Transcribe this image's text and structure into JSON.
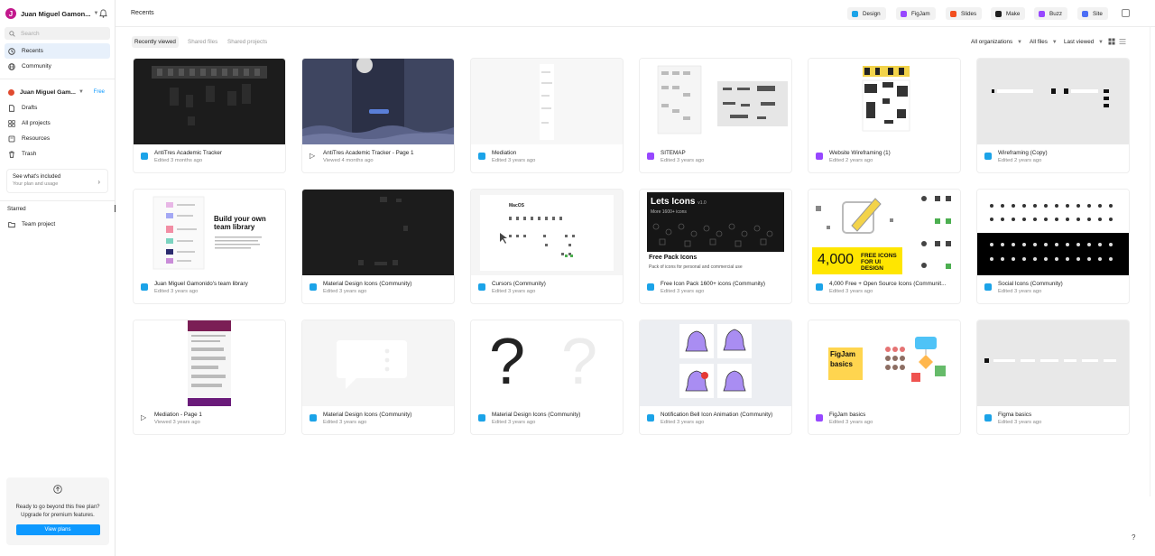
{
  "sidebar": {
    "avatar_initial": "J",
    "user_name": "Juan Miguel Gamon...",
    "search_placeholder": "Search",
    "nav": [
      {
        "label": "Recents",
        "icon": "clock-icon",
        "active": true
      },
      {
        "label": "Community",
        "icon": "globe-icon",
        "active": false
      }
    ],
    "team": {
      "name": "Juan Miguel Gam...",
      "badge": "Free"
    },
    "team_nav": [
      {
        "label": "Drafts",
        "icon": "file-icon"
      },
      {
        "label": "All projects",
        "icon": "grid-icon"
      },
      {
        "label": "Resources",
        "icon": "book-icon"
      },
      {
        "label": "Trash",
        "icon": "trash-icon"
      }
    ],
    "plan": {
      "title": "See what's included",
      "subtitle": "Your plan and usage"
    },
    "starred": {
      "heading": "Starred",
      "items": [
        "Team project"
      ]
    },
    "upgrade": {
      "text": "Ready to go beyond this free plan? Upgrade for premium features.",
      "button": "View plans"
    }
  },
  "header": {
    "title": "Recents",
    "products": [
      {
        "label": "Design",
        "color": "#1ba3e8"
      },
      {
        "label": "FigJam",
        "color": "#9747ff"
      },
      {
        "label": "Slides",
        "color": "#f24e1e"
      },
      {
        "label": "Make",
        "color": "#1e1e1e"
      },
      {
        "label": "Buzz",
        "color": "#9747ff"
      },
      {
        "label": "Site",
        "color": "#4c6ef5"
      }
    ]
  },
  "filters": {
    "tabs": [
      "Recently viewed",
      "Shared files",
      "Shared projects"
    ],
    "org": "All organizations",
    "files": "All files",
    "sort": "Last viewed"
  },
  "files": [
    {
      "title": "AntiTres Academic Tracker",
      "meta": "Edited 3 months ago",
      "kind": "design"
    },
    {
      "title": "AntiTres Academic Tracker - Page 1",
      "meta": "Viewed 4 months ago",
      "kind": "slide"
    },
    {
      "title": "Mediation",
      "meta": "Edited 3 years ago",
      "kind": "design"
    },
    {
      "title": "SITEMAP",
      "meta": "Edited 3 years ago",
      "kind": "figjam"
    },
    {
      "title": "Website Wireframing (1)",
      "meta": "Edited 2 years ago",
      "kind": "figjam"
    },
    {
      "title": "Wireframing (Copy)",
      "meta": "Edited 2 years ago",
      "kind": "design"
    },
    {
      "title": "Juan Miguel Gamonido's team library",
      "meta": "Edited 3 years ago",
      "kind": "design"
    },
    {
      "title": "Material Design Icons (Community)",
      "meta": "Edited 3 years ago",
      "kind": "design"
    },
    {
      "title": "Cursors (Community)",
      "meta": "Edited 3 years ago",
      "kind": "design"
    },
    {
      "title": "Free Icon Pack 1600+ icons (Community)",
      "meta": "Edited 3 years ago",
      "kind": "design"
    },
    {
      "title": "4,000 Free + Open Source Icons (Communit...",
      "meta": "Edited 3 years ago",
      "kind": "design"
    },
    {
      "title": "Social Icons (Community)",
      "meta": "Edited 3 years ago",
      "kind": "design"
    },
    {
      "title": "Mediation - Page 1",
      "meta": "Viewed 3 years ago",
      "kind": "slide"
    },
    {
      "title": "Material Design Icons (Community)",
      "meta": "Edited 3 years ago",
      "kind": "design"
    },
    {
      "title": "Material Design Icons (Community)",
      "meta": "Edited 3 years ago",
      "kind": "design"
    },
    {
      "title": "Notification Bell Icon Animation (Community)",
      "meta": "Edited 3 years ago",
      "kind": "design"
    },
    {
      "title": "FigJam basics",
      "meta": "Edited 3 years ago",
      "kind": "figjam"
    },
    {
      "title": "Figma basics",
      "meta": "Edited 3 years ago",
      "kind": "design"
    }
  ],
  "thumb_text": {
    "library_heading": "Build your own team library",
    "cursors_title": "MacOS",
    "lets_icons_title": "Lets Icons",
    "lets_icons_version": "v1.0",
    "lets_icons_sub": "More 1600+ icons",
    "lets_icons_pack": "Free Pack Icons",
    "lets_icons_desc": "Pack of icons for personal and commercial use",
    "free_icons_count": "4,000",
    "free_icons_label": "FREE ICONS FOR UI DESIGN",
    "question": "?",
    "figjam_label": "FigJam basics"
  },
  "help": "?"
}
